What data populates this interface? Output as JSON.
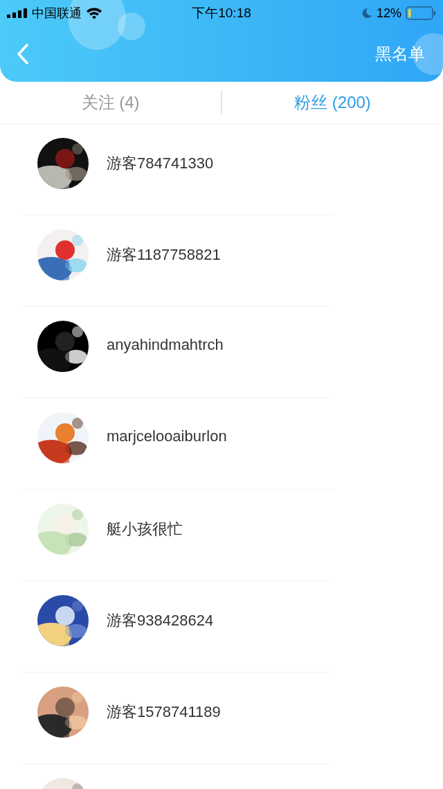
{
  "status_bar": {
    "carrier": "中国联通",
    "time": "下午10:18",
    "battery": "12%"
  },
  "header": {
    "action": "黑名单"
  },
  "tabs": [
    {
      "label": "关注 (4)",
      "selected": false
    },
    {
      "label": "粉丝 (200)",
      "selected": true
    }
  ],
  "users": [
    {
      "name": "游客784741330",
      "avatar": {
        "kind": "picture"
      }
    },
    {
      "name": "游客1187758821",
      "avatar": {
        "kind": "picture"
      }
    },
    {
      "name": "anyahindmahtrch",
      "avatar": {
        "kind": "picture"
      }
    },
    {
      "name": "marjcelooaiburlon",
      "avatar": {
        "kind": "picture"
      }
    },
    {
      "name": "艇小孩很忙",
      "avatar": {
        "kind": "picture"
      }
    },
    {
      "name": "游客938428624",
      "avatar": {
        "kind": "picture"
      }
    },
    {
      "name": "游客1578741189",
      "avatar": {
        "kind": "picture"
      }
    },
    {
      "avatar": {
        "kind": "picture"
      }
    }
  ]
}
